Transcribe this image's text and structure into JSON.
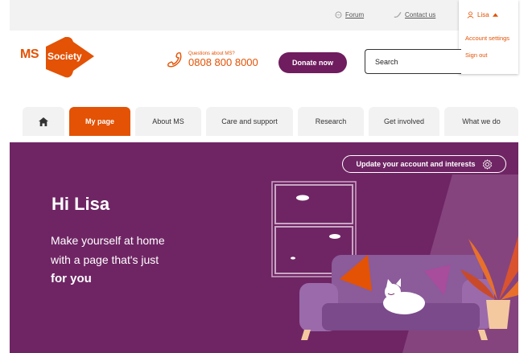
{
  "utility_bar": {
    "forum_label": "Forum",
    "contact_label": "Contact us",
    "user_name": "Lisa",
    "user_menu": {
      "account_settings": "Account settings",
      "sign_out": "Sign out"
    }
  },
  "header": {
    "logo_ms": "MS",
    "logo_society": "Society",
    "phone_prompt": "Questions about MS?",
    "phone_number": "0808 800 8000",
    "donate_label": "Donate now",
    "search_placeholder": "Search"
  },
  "nav": {
    "tabs": [
      {
        "label": "My page",
        "active": true
      },
      {
        "label": "About MS"
      },
      {
        "label": "Care and support"
      },
      {
        "label": "Research"
      },
      {
        "label": "Get involved"
      },
      {
        "label": "What we do"
      }
    ]
  },
  "hero": {
    "update_button_label": "Update your account and interests",
    "greeting": "Hi Lisa",
    "line1": "Make yourself at home",
    "line2": "with a page that's just",
    "line3": "for you"
  },
  "colors": {
    "brand_orange": "#e35205",
    "brand_purple": "#6f2564",
    "donate_purple": "#6f1d5e"
  }
}
